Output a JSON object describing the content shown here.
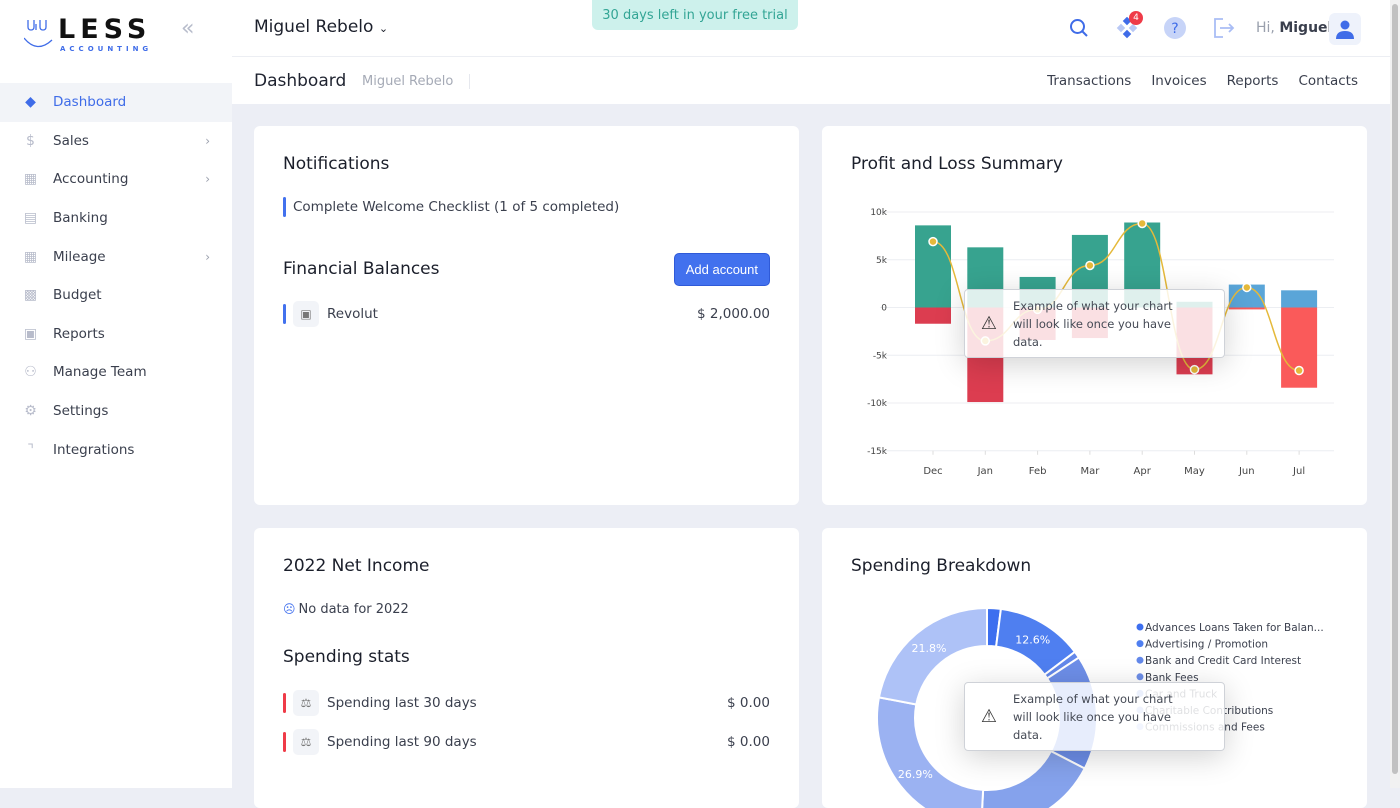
{
  "brand": {
    "name": "LESS",
    "tagline": "ACCOUNTING"
  },
  "sidebar": {
    "items": [
      {
        "label": "Dashboard",
        "icon": "layers-icon",
        "active": true
      },
      {
        "label": "Sales",
        "icon": "dollar-icon",
        "chevron": true
      },
      {
        "label": "Accounting",
        "icon": "grid-icon",
        "chevron": true
      },
      {
        "label": "Banking",
        "icon": "card-icon"
      },
      {
        "label": "Mileage",
        "icon": "grid-icon",
        "chevron": true
      },
      {
        "label": "Budget",
        "icon": "calculator-icon"
      },
      {
        "label": "Reports",
        "icon": "document-icon"
      },
      {
        "label": "Manage Team",
        "icon": "users-icon"
      },
      {
        "label": "Settings",
        "icon": "gear-icon"
      },
      {
        "label": "Integrations",
        "icon": "switch-icon"
      }
    ]
  },
  "header": {
    "company": "Miguel Rebelo",
    "trial": "30 days left in your free trial",
    "notif_count": "4",
    "greeting": "Hi,",
    "user": "Miguel"
  },
  "subheader": {
    "title": "Dashboard",
    "crumb": "Miguel Rebelo",
    "links": [
      "Transactions",
      "Invoices",
      "Reports",
      "Contacts"
    ]
  },
  "notifications": {
    "title": "Notifications",
    "items": [
      "Complete Welcome Checklist (1 of 5 completed)"
    ]
  },
  "balances": {
    "title": "Financial Balances",
    "add_label": "Add account",
    "accounts": [
      {
        "name": "Revolut",
        "amount": "$ 2,000.00"
      }
    ]
  },
  "net_income": {
    "title": "2022 Net Income",
    "empty": "No data for 2022"
  },
  "spending": {
    "title": "Spending stats",
    "items": [
      {
        "label": "Spending last 30 days",
        "amount": "$ 0.00"
      },
      {
        "label": "Spending last 90 days",
        "amount": "$ 0.00"
      }
    ]
  },
  "overlay_text": "Example of what your chart will look like once you have data.",
  "colors": {
    "accent": "#4271ee",
    "income": "#37a38f",
    "expense": "#dc3d50",
    "income_alt": "#5aa5d8",
    "expense_alt": "#fa5a5a",
    "net_line": "#e5b93a"
  },
  "chart_data": [
    {
      "type": "bar",
      "title": "Profit and Loss Summary",
      "categories": [
        "Dec",
        "Jan",
        "Feb",
        "Mar",
        "Apr",
        "May",
        "Jun",
        "Jul"
      ],
      "series": [
        {
          "values": [
            8.6,
            6.3,
            3.2,
            7.6,
            8.9,
            0.6,
            2.4,
            1.8
          ]
        },
        {
          "values": [
            -1.7,
            -9.9,
            -3.4,
            -3.2,
            0,
            -7.0,
            -0.2,
            -8.4
          ]
        },
        {
          "type": "line",
          "values": [
            6.9,
            -3.5,
            -0.2,
            4.4,
            8.8,
            -6.5,
            2.1,
            -6.6
          ]
        }
      ],
      "yticks": [
        "10k",
        "5k",
        "0",
        "-5k",
        "-10k",
        "-15k"
      ],
      "ylim": [
        -15,
        10
      ],
      "grid": true
    },
    {
      "type": "pie",
      "title": "Spending Breakdown",
      "slices": [
        {
          "label": "Advances Loans Taken for Balan...",
          "value": 2.0,
          "color": "#3d6fef"
        },
        {
          "label": "Advertising / Promotion",
          "value": 12.6,
          "color": "#4f7ff0"
        },
        {
          "label": "Bank and Credit Card Interest",
          "value": 1.0,
          "color": "#6388ea"
        },
        {
          "label": "Bank Fees",
          "value": 16.7,
          "color": "#6d8ee8"
        },
        {
          "label": "Car and Truck",
          "value": 18.1,
          "color": "#85a2ec"
        },
        {
          "label": "Charitable Contributions",
          "value": 26.9,
          "color": "#9bb2f2"
        },
        {
          "label": "Commissions and Fees",
          "value": 21.8,
          "color": "#aec2f7"
        }
      ],
      "data_labels": [
        "12.6%",
        "21.8%",
        "26.9%"
      ],
      "legend": "right"
    }
  ]
}
